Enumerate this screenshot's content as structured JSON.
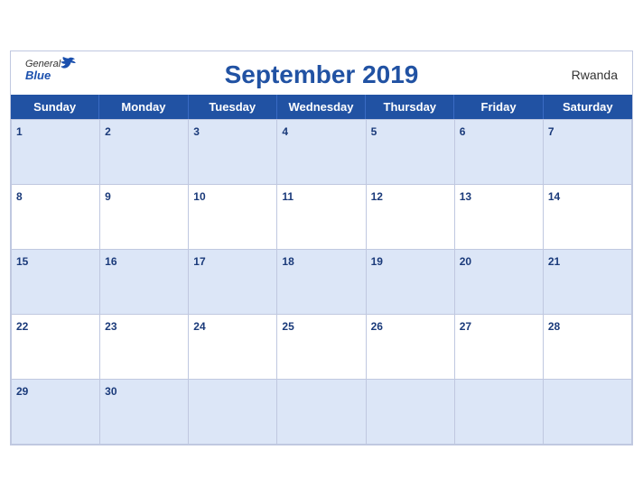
{
  "header": {
    "title": "September 2019",
    "country": "Rwanda",
    "brand_general": "General",
    "brand_blue": "Blue"
  },
  "days": [
    "Sunday",
    "Monday",
    "Tuesday",
    "Wednesday",
    "Thursday",
    "Friday",
    "Saturday"
  ],
  "weeks": [
    [
      1,
      2,
      3,
      4,
      5,
      6,
      7
    ],
    [
      8,
      9,
      10,
      11,
      12,
      13,
      14
    ],
    [
      15,
      16,
      17,
      18,
      19,
      20,
      21
    ],
    [
      22,
      23,
      24,
      25,
      26,
      27,
      28
    ],
    [
      29,
      30,
      null,
      null,
      null,
      null,
      null
    ]
  ]
}
